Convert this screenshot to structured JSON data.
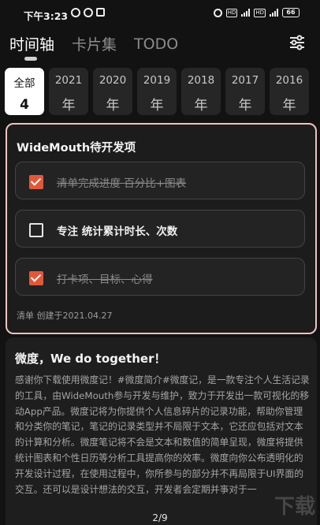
{
  "status_bar": {
    "time": "下午3:23",
    "network_labels": [
      "HD",
      "HD"
    ],
    "battery": "66"
  },
  "nav": {
    "tabs": [
      {
        "label": "时间轴"
      },
      {
        "label": "卡片集"
      },
      {
        "label": "TODO"
      }
    ],
    "settings_icon": "sliders-icon"
  },
  "years": [
    {
      "label": "全部",
      "count": "4"
    },
    {
      "label": "2021",
      "count": "年"
    },
    {
      "label": "2020",
      "count": "年"
    },
    {
      "label": "2019",
      "count": "年"
    },
    {
      "label": "2018",
      "count": "年"
    },
    {
      "label": "2017",
      "count": "年"
    },
    {
      "label": "2016",
      "count": "年"
    }
  ],
  "todo_card": {
    "title": "WideMouth待开发项",
    "items": [
      {
        "text": "清单完成进度 百分比+图表",
        "checked": true
      },
      {
        "text": "专注 统计累计时长、次数",
        "checked": false
      },
      {
        "text": "打卡项、目标、心得",
        "checked": true
      }
    ],
    "meta": "清单  创建于2021.04.27"
  },
  "note_card": {
    "title": "微度，We do together！",
    "body": "感谢你下载使用微度记！#微度简介#微度记，是一款专注个人生活记录的工具，由WideMouth参与开发与维护，致力于开发出一款可视化的移动App产品。微度记将为你提供个人信息碎片的记录功能，帮助你管理和分类你的笔记，笔记的记录类型并不局限于文本，它还应包括对文本的计算和分析。微度笔记将不会是文本和数值的简单呈现，微度将提供统计图表和个性日历等分析工具提高你的效率。微度向你公布透明化的开发设计过程，在使用过程中，你所参与的部分并不再局限于UI界面的交互。还可以是设计想法的交互，开发者会定期并亊对于一"
  },
  "pager": "2/9",
  "colors": {
    "background": "#121212",
    "card": "#1c1c1c",
    "accent": "#e0583a",
    "highlight_border": "#f0c2c2"
  }
}
